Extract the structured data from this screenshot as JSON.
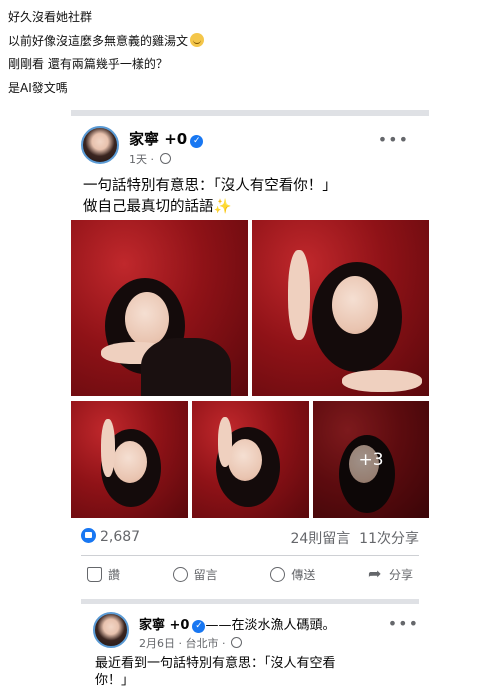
{
  "intro_lines": [
    "好久沒看她社群",
    "以前好像沒這麼多無意義的雞湯文",
    "剛剛看 還有兩篇幾乎一樣的？",
    "是AI發文嗎"
  ],
  "intro_emoji": "smiling-face-emoji",
  "post1": {
    "author": "家寧 +0",
    "verified_icon": "verified-badge-icon",
    "time": "1天",
    "audience_icon": "globe-icon",
    "text_line1": "一句話特別有意思：「沒人有空看你！」",
    "text_line2": "做自己最真切的話語",
    "text_emoji": "✨",
    "more_photos": "+3",
    "reaction_count": "2,687",
    "comments": "24則留言",
    "shares": "11次分享",
    "actions": {
      "like": "讚",
      "comment": "留言",
      "send": "傳送",
      "share": "分享"
    }
  },
  "post2": {
    "author": "家寧 +0",
    "location_suffix": "——在淡水漁人碼頭。",
    "meta": "2月6日 · 台北市 ·",
    "text": "最近看到一句話特別有意思：「沒人有空看",
    "text_line2": "你！」"
  },
  "colors": {
    "accent": "#1877f2",
    "photo_red": "#a3161c"
  }
}
